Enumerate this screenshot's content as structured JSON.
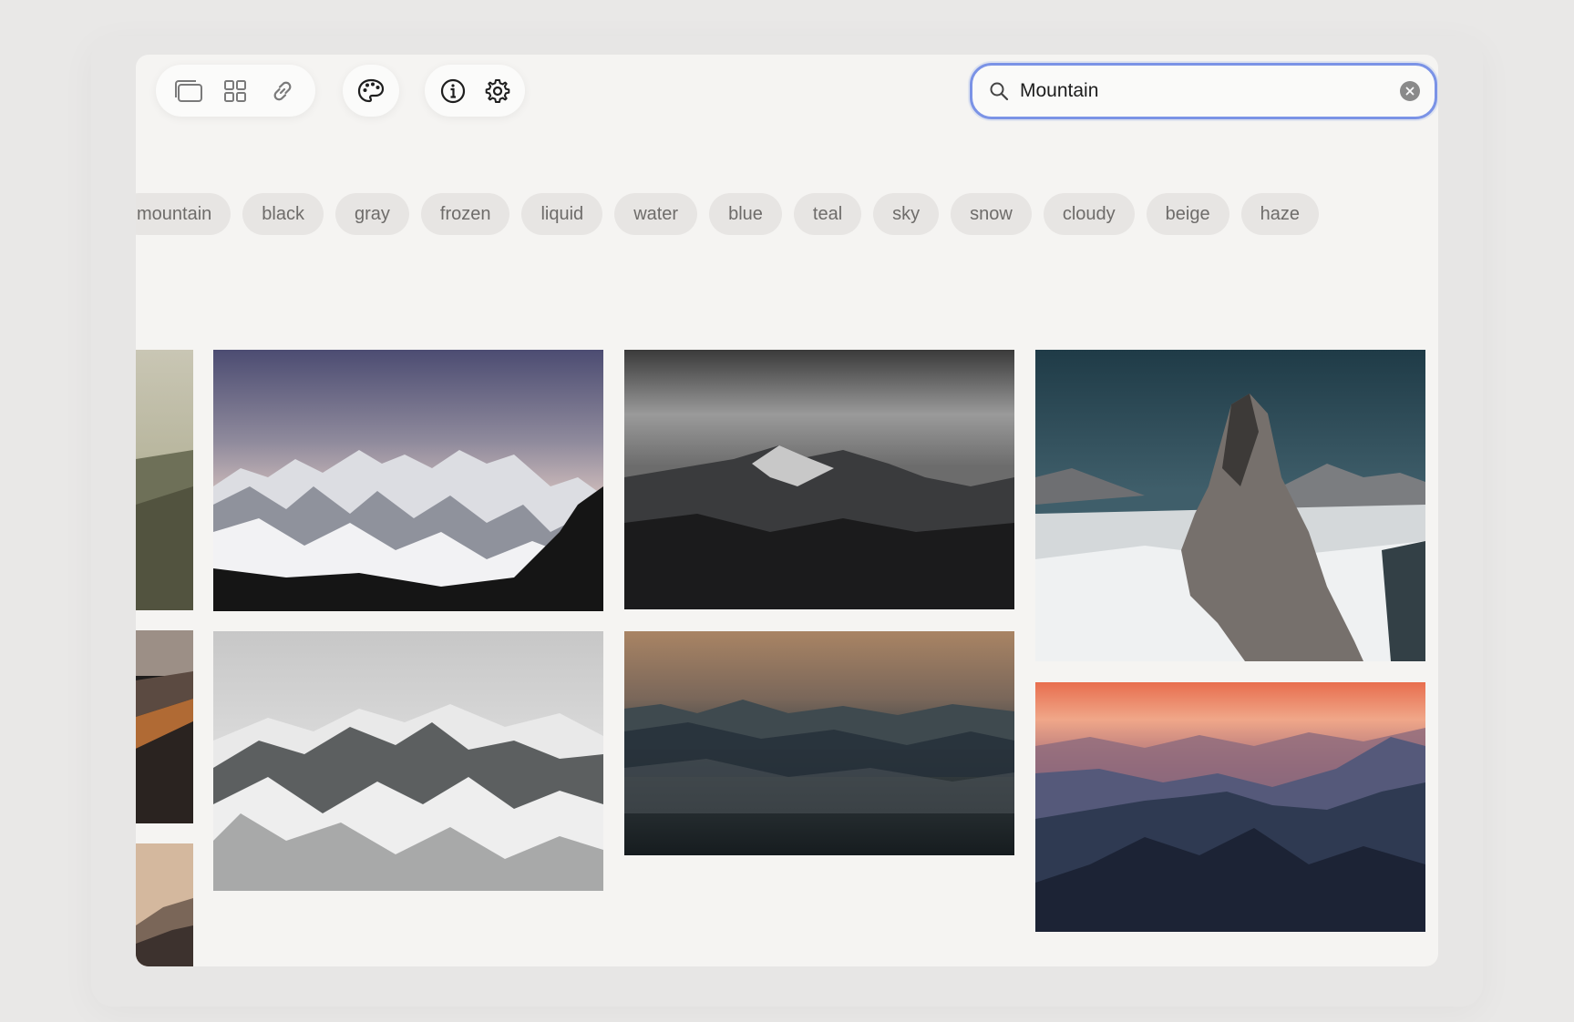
{
  "toolbar": {
    "group_view": [
      {
        "icon": "stack-icon",
        "name": "stack-view-button"
      },
      {
        "icon": "grid-icon",
        "name": "grid-view-button"
      },
      {
        "icon": "link-icon",
        "name": "link-button"
      }
    ],
    "group_palette": [
      {
        "icon": "palette-icon",
        "name": "palette-button"
      }
    ],
    "group_info": [
      {
        "icon": "info-icon",
        "name": "info-button"
      },
      {
        "icon": "gear-icon",
        "name": "settings-button"
      }
    ]
  },
  "search": {
    "value": "Mountain",
    "placeholder": "",
    "accent_color": "#7b93e6"
  },
  "tags": [
    "mountain",
    "black",
    "gray",
    "frozen",
    "liquid",
    "water",
    "blue",
    "teal",
    "sky",
    "snow",
    "cloudy",
    "beige",
    "haze"
  ],
  "images": [
    {
      "name": "partial-green-hillside-photo"
    },
    {
      "name": "partial-orange-ridge-photo"
    },
    {
      "name": "partial-beige-peak-photo"
    },
    {
      "name": "snowy-alps-dusk-photo"
    },
    {
      "name": "dark-cloudy-peak-photo"
    },
    {
      "name": "rocky-spire-above-clouds-photo"
    },
    {
      "name": "snow-covered-ridge-photo"
    },
    {
      "name": "orange-haze-cloud-sea-photo"
    },
    {
      "name": "sunset-blue-mountain-range-photo"
    }
  ]
}
